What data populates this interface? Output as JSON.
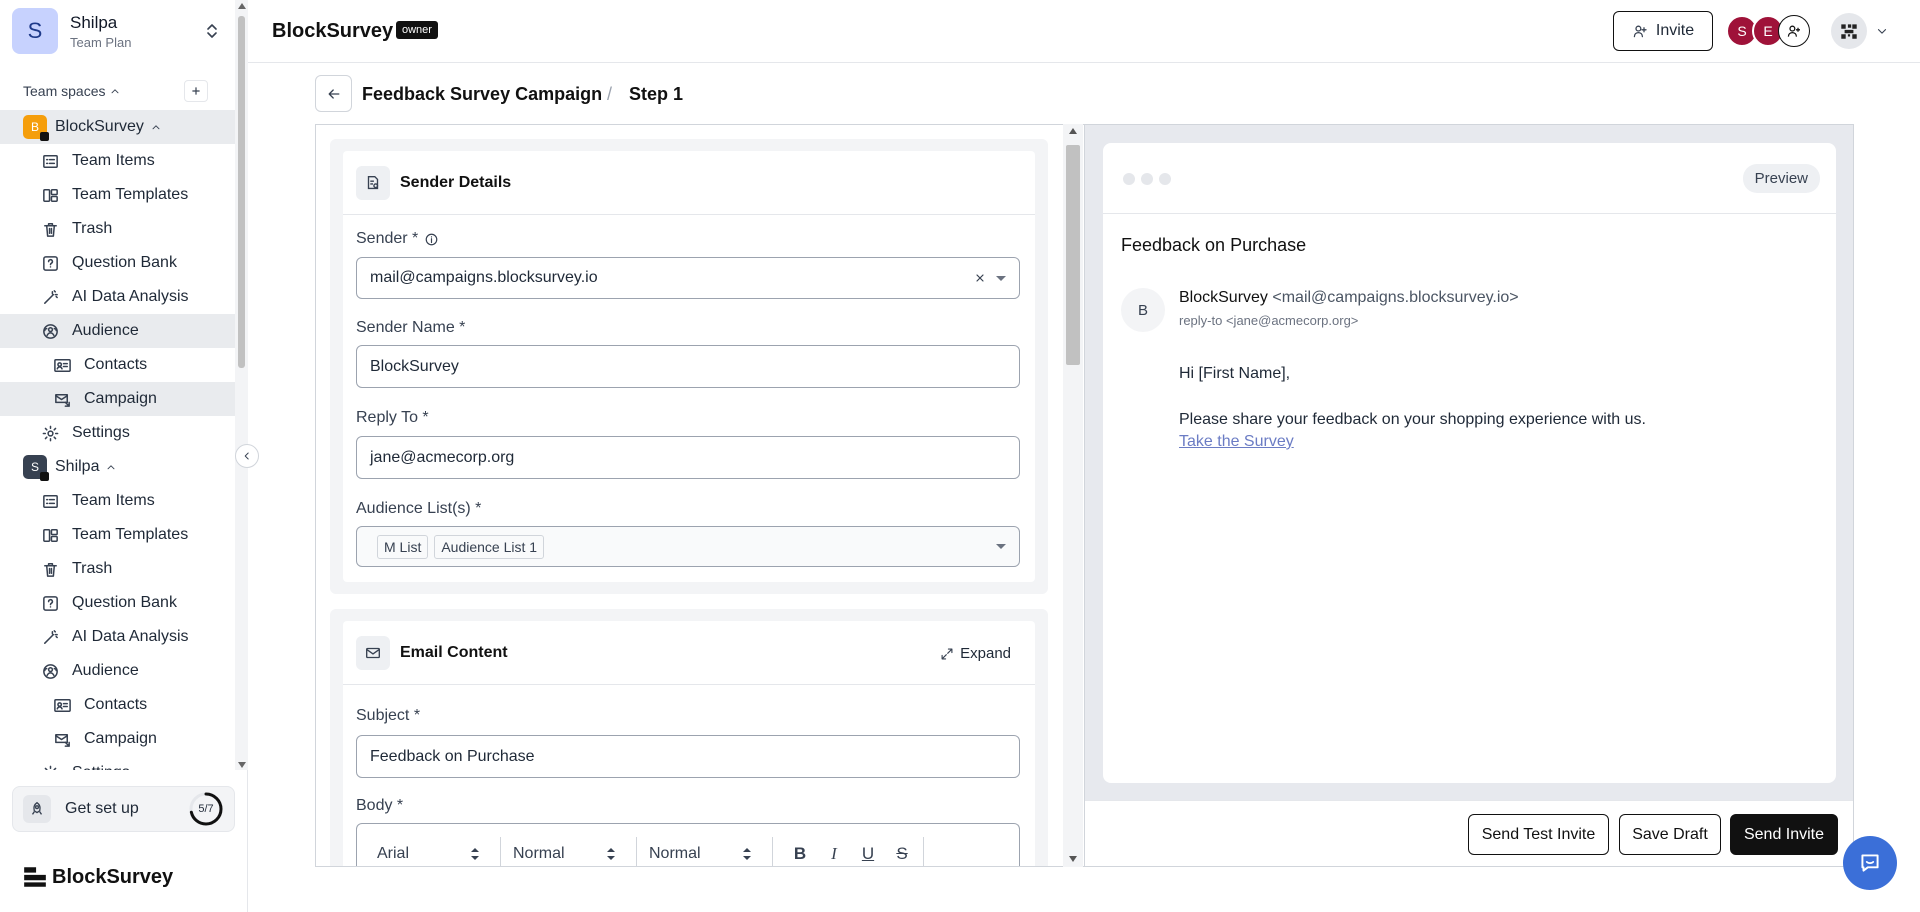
{
  "sidebar": {
    "user": {
      "initial": "S",
      "name": "Shilpa",
      "plan": "Team Plan"
    },
    "team_spaces_label": "Team spaces",
    "spaces": [
      {
        "badge": "B",
        "badge_color": "#f59e0b",
        "name": "BlockSurvey",
        "items": [
          {
            "label": "Team Items",
            "icon": "list-icon"
          },
          {
            "label": "Team Templates",
            "icon": "template-icon"
          },
          {
            "label": "Trash",
            "icon": "trash-icon"
          },
          {
            "label": "Question Bank",
            "icon": "question-icon"
          },
          {
            "label": "AI Data Analysis",
            "icon": "magic-wand-icon"
          },
          {
            "label": "Audience",
            "icon": "audience-icon"
          },
          {
            "label": "Contacts",
            "icon": "contacts-icon"
          },
          {
            "label": "Campaign",
            "icon": "campaign-mail-icon"
          },
          {
            "label": "Settings",
            "icon": "gear-icon"
          }
        ]
      },
      {
        "badge": "S",
        "badge_color": "#374151",
        "name": "Shilpa",
        "items": [
          {
            "label": "Team Items",
            "icon": "list-icon"
          },
          {
            "label": "Team Templates",
            "icon": "template-icon"
          },
          {
            "label": "Trash",
            "icon": "trash-icon"
          },
          {
            "label": "Question Bank",
            "icon": "question-icon"
          },
          {
            "label": "AI Data Analysis",
            "icon": "magic-wand-icon"
          },
          {
            "label": "Audience",
            "icon": "audience-icon"
          },
          {
            "label": "Contacts",
            "icon": "contacts-icon"
          },
          {
            "label": "Campaign",
            "icon": "campaign-mail-icon"
          },
          {
            "label": "Settings",
            "icon": "gear-icon"
          }
        ]
      }
    ],
    "get_set_up": {
      "label": "Get set up",
      "progress_text": "5/7",
      "progress_fraction": 0.714
    },
    "brand": "BlockSurvey"
  },
  "topbar": {
    "workspace_title": "BlockSurvey",
    "role_badge": "owner",
    "invite_label": "Invite",
    "members": [
      {
        "initial": "S",
        "color": "#9f1239"
      },
      {
        "initial": "E",
        "color": "#9f1239"
      }
    ]
  },
  "breadcrumb": {
    "campaign": "Feedback Survey Campaign",
    "separator": "/",
    "step": "Step 1"
  },
  "sender_details": {
    "title": "Sender Details",
    "sender_label": "Sender *",
    "sender_value": "mail@campaigns.blocksurvey.io",
    "sender_name_label": "Sender Name *",
    "sender_name_value": "BlockSurvey",
    "reply_to_label": "Reply To *",
    "reply_to_value": "jane@acmecorp.org",
    "audience_label": "Audience List(s) *",
    "audience_tags": [
      "M List",
      "Audience List 1"
    ]
  },
  "email_content": {
    "title": "Email Content",
    "expand_label": "Expand",
    "subject_label": "Subject *",
    "subject_value": "Feedback on Purchase",
    "body_label": "Body *",
    "toolbar": {
      "font": "Arial",
      "size": "Normal",
      "style": "Normal",
      "bold": "B",
      "italic": "I",
      "underline": "U",
      "strike": "S"
    }
  },
  "preview": {
    "pill": "Preview",
    "subject": "Feedback on Purchase",
    "avatar_initial": "B",
    "from_name": "BlockSurvey",
    "from_email": "<mail@campaigns.blocksurvey.io>",
    "reply_to": "reply-to <jane@acmecorp.org>",
    "greeting": "Hi [First Name],",
    "message": "Please share your feedback on your shopping experience with us.",
    "link_text": "Take the Survey"
  },
  "actions": {
    "send_test": "Send Test Invite",
    "save_draft": "Save Draft",
    "send": "Send Invite"
  }
}
